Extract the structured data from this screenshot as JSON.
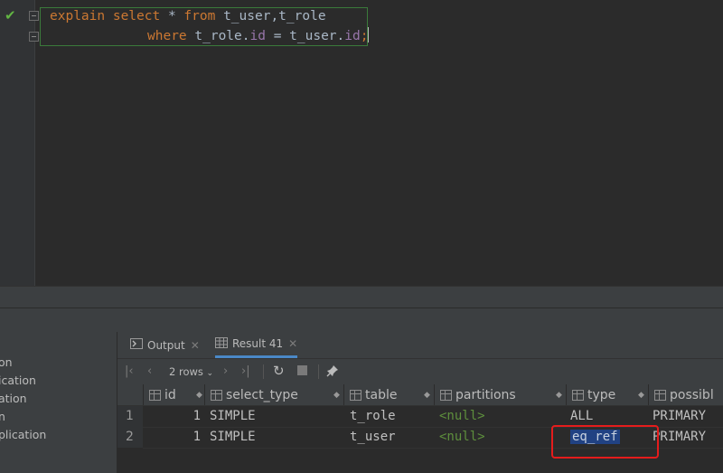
{
  "editor": {
    "line1": [
      {
        "text": "explain select ",
        "kind": "kw"
      },
      {
        "text": "* ",
        "kind": "plain"
      },
      {
        "text": "from ",
        "kind": "kw"
      },
      {
        "text": "t_user,t_role",
        "kind": "plain"
      }
    ],
    "line2": [
      {
        "text": "where ",
        "kind": "kw"
      },
      {
        "text": "t_role.",
        "kind": "plain"
      },
      {
        "text": "id",
        "kind": "fld"
      },
      {
        "text": " = t_user.",
        "kind": "plain"
      },
      {
        "text": "id",
        "kind": "fld"
      },
      {
        "text": ";",
        "kind": "kw"
      }
    ],
    "status_icon": "checkmark-icon"
  },
  "sidebar": {
    "items": [
      "on",
      "ication",
      "ation",
      "n",
      "plication"
    ]
  },
  "tabs": [
    {
      "label": "Output",
      "icon": "output-icon"
    },
    {
      "label": "Result 41",
      "icon": "table-grid-icon"
    }
  ],
  "toolbar": {
    "rows_label": "2 rows",
    "icons": [
      "first-page-icon",
      "prev-page-icon",
      "next-page-icon",
      "last-page-icon",
      "refresh-icon",
      "stop-icon",
      "pin-icon"
    ]
  },
  "grid": {
    "columns": [
      "id",
      "select_type",
      "table",
      "partitions",
      "type",
      "possibl"
    ],
    "rows": [
      {
        "num": "1",
        "id": "1",
        "select_type": "SIMPLE",
        "table": "t_role",
        "partitions": "<null>",
        "type": "ALL",
        "possible_keys": "PRIMARY"
      },
      {
        "num": "2",
        "id": "1",
        "select_type": "SIMPLE",
        "table": "t_user",
        "partitions": "<null>",
        "type": "eq_ref",
        "possible_keys": "PRIMARY"
      }
    ]
  },
  "colors": {
    "background": "#2b2b2b",
    "keyword": "#cc7832",
    "field": "#9876aa",
    "null": "#5e8f3d",
    "selection": "#214283",
    "annotation": "#e51c1c"
  }
}
